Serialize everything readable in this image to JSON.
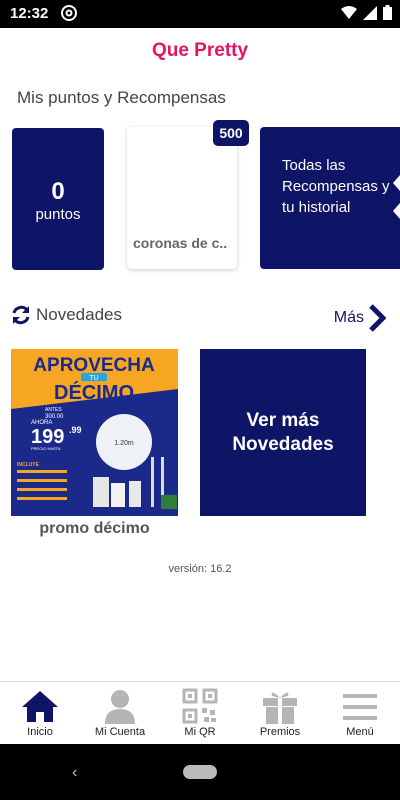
{
  "status_bar": {
    "time": "12:32"
  },
  "app_title": "Que Pretty",
  "rewards_section": {
    "title": "Mis puntos y Recompensas",
    "points_value": "0",
    "points_label": "puntos",
    "coronas_label": "coronas de c..",
    "coronas_badge": "500",
    "all_rewards_label": "Todas las Recompensas y tu historial"
  },
  "news_section": {
    "title": "Novedades",
    "more_label": "Más",
    "promo_caption": "promo décimo",
    "more_news_label": "Ver más Novedades",
    "promo_poster": {
      "line1": "APROVECHA",
      "tag": "TU",
      "line2": "DÉCIMO",
      "antes": "ANTES",
      "old_price": "300.00",
      "ahora": "AHORA",
      "price_int": "199",
      "price_dec": ".99",
      "price_note": "PRECIO HASTA",
      "size": "1.20m",
      "incluye": "INCLUYE"
    }
  },
  "version": "versión: 16.2",
  "bottom_nav": [
    {
      "label": "Inicio",
      "icon": "home-icon"
    },
    {
      "label": "Mi Cuenta",
      "icon": "user-icon"
    },
    {
      "label": "Mi QR",
      "icon": "qr-icon"
    },
    {
      "label": "Premios",
      "icon": "gift-icon"
    },
    {
      "label": "Menú",
      "icon": "menu-icon"
    }
  ],
  "colors": {
    "brand": "#e8135f",
    "navy": "#0f1566",
    "active_nav": "#0f1566",
    "inactive_nav": "#b5b5b5"
  }
}
